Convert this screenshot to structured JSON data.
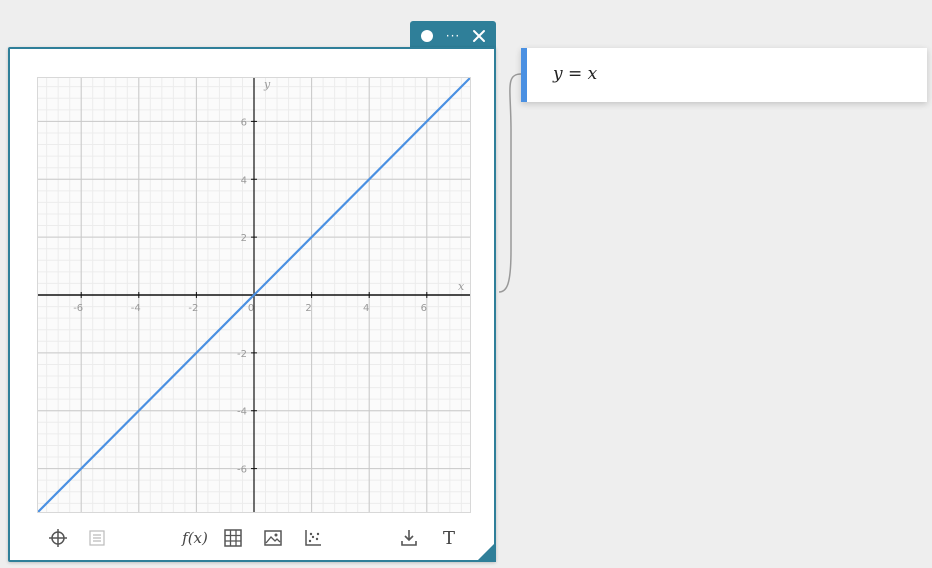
{
  "window_tab": {
    "buttons": [
      "settings-dot",
      "more",
      "close"
    ],
    "more_label": "···"
  },
  "expression": {
    "text": "y = x",
    "color": "#4a90e2"
  },
  "toolbar": {
    "function_label": "f(x)",
    "text_label": "T"
  },
  "colors": {
    "accent": "#2f7f99",
    "line": "#4a90e2"
  },
  "chart_data": {
    "type": "line",
    "xlabel": "x",
    "ylabel": "y",
    "xlim": [
      -7.5,
      7.5
    ],
    "ylim": [
      -7.5,
      7.5
    ],
    "x_ticks": [
      -6,
      -4,
      -2,
      0,
      2,
      4,
      6
    ],
    "y_ticks": [
      -6,
      -4,
      -2,
      2,
      4,
      6
    ],
    "x_tick_labels": [
      "-6",
      "-4",
      "-2",
      "0",
      "2",
      "4",
      "6"
    ],
    "y_tick_labels": [
      "-6",
      "-4",
      "-2",
      "2",
      "4",
      "6"
    ],
    "grid": true,
    "series": [
      {
        "name": "y = x",
        "x": [
          -7.5,
          7.5
        ],
        "y": [
          -7.5,
          7.5
        ]
      }
    ]
  }
}
